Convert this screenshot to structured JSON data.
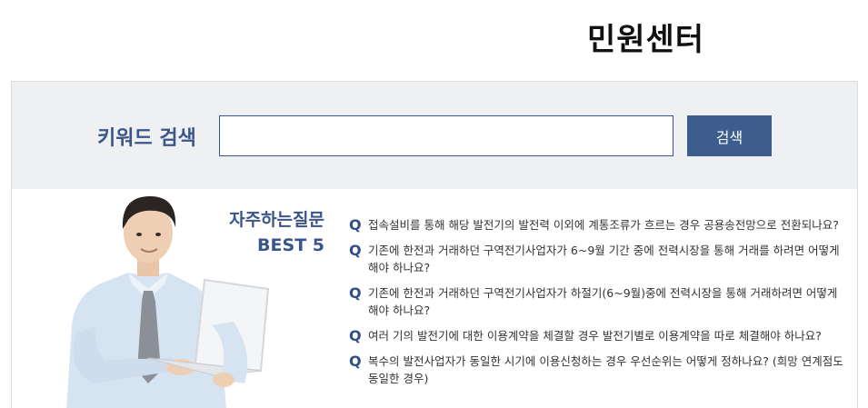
{
  "header": {
    "title": "민원센터"
  },
  "search": {
    "label": "키워드 검색",
    "input_value": "",
    "button_label": "검색"
  },
  "faq": {
    "heading_line1": "자주하는질문",
    "heading_line2": "BEST 5",
    "q_marker": "Q",
    "items": [
      {
        "text": "접속설비를 통해 해당 발전기의 발전력 이외에 계통조류가 흐르는 경우 공용송전망으로 전환되나요?"
      },
      {
        "text": "기존에 한전과 거래하던 구역전기사업자가 6~9월 기간 중에 전력시장을 통해 거래를 하려면 어떻게 해야 하나요?"
      },
      {
        "text": "기존에 한전과 거래하던 구역전기사업자가 하절기(6~9월)중에 전력시장을 통해 거래하려면 어떻게 해야 하나요?"
      },
      {
        "text": "여러 기의 발전기에 대한 이용계약을 체결할 경우 발전기별로 이용계약을 따로 체결해야 하나요?"
      },
      {
        "text": "복수의 발전사업자가 동일한 시기에 이용신청하는 경우 우선순위는 어떻게 정하나요? (희망 연계점도 동일한 경우)"
      }
    ]
  },
  "colors": {
    "accent": "#3a5589",
    "button": "#3c5d8e",
    "search_bg": "#eff0f2"
  }
}
